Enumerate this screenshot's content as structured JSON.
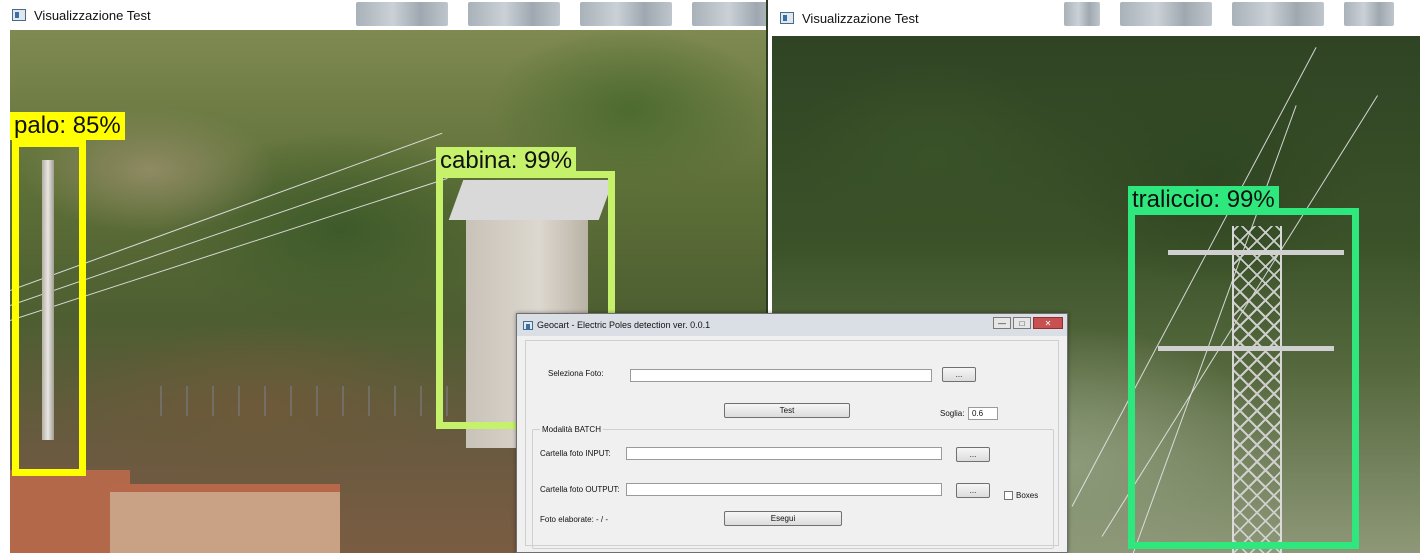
{
  "left_window": {
    "title": "Visualizzazione Test",
    "detections": [
      {
        "label": "palo: 85%",
        "color": "#ffff00"
      },
      {
        "label": "cabina: 99%",
        "color": "#c6f26b"
      }
    ]
  },
  "right_window": {
    "title": "Visualizzazione Test",
    "detections": [
      {
        "label": "traliccio: 99%",
        "color": "#2ee87d"
      }
    ]
  },
  "dialog": {
    "title": "Geocart - Electric Poles detection ver. 0.0.1",
    "controls": {
      "minimize": "—",
      "maximize": "□",
      "close": "✕"
    },
    "select_photo_label": "Seleziona Foto:",
    "select_photo_value": "",
    "browse_label": "...",
    "test_button": "Test",
    "threshold_label": "Soglia:",
    "threshold_value": "0.6",
    "batch_group_label": "Modalità BATCH",
    "input_folder_label": "Cartella foto INPUT:",
    "input_folder_value": "",
    "output_folder_label": "Cartella foto OUTPUT:",
    "output_folder_value": "",
    "boxes_label": "Boxes",
    "processed_label": "Foto elaborate: - / -",
    "run_button": "Esegui"
  }
}
